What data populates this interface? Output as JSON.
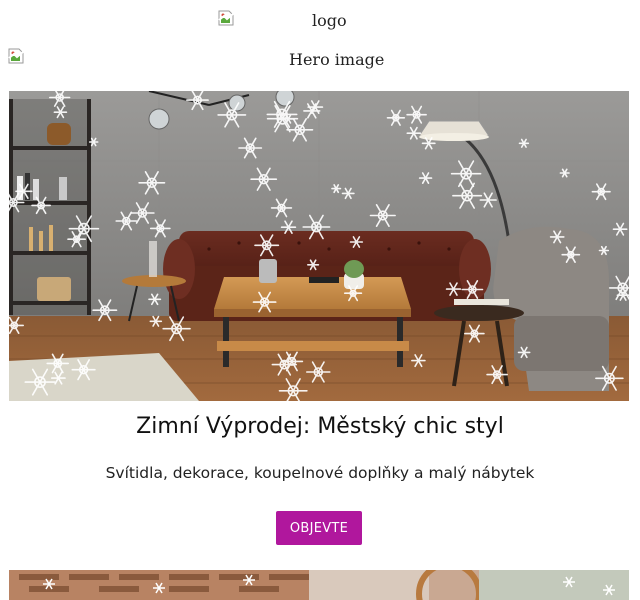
{
  "logo": {
    "alt": "logo"
  },
  "hero": {
    "alt": "Hero image"
  },
  "promo": {
    "title": "Zimní Výprodej: Městský chic styl",
    "subtitle": "Svítidla, dekorace, koupelnové doplňky a malý nábytek",
    "cta_label": "OBJEVTE",
    "cta_color": "#b0179d"
  },
  "icons": {
    "broken_image": "broken-image-icon",
    "snowflake": "snowflake-icon"
  }
}
